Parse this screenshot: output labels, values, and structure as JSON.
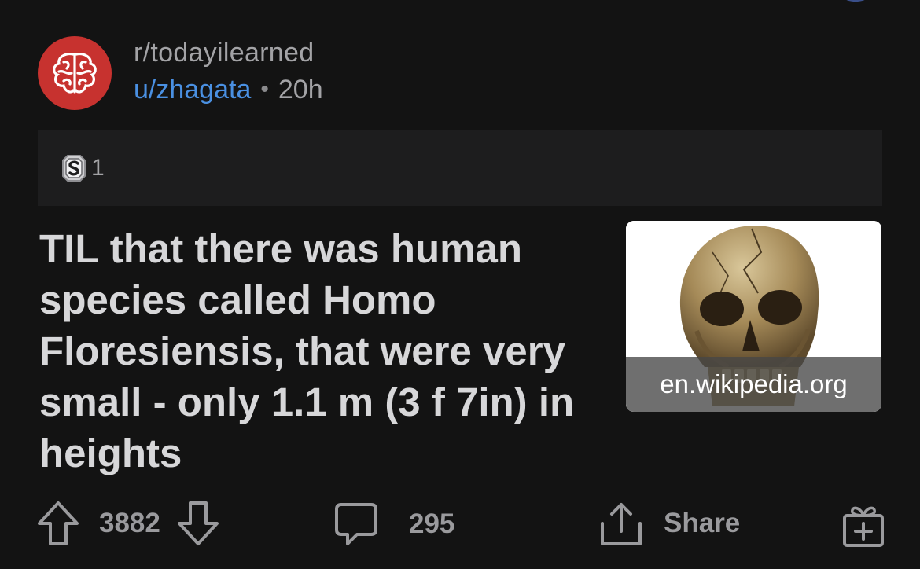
{
  "post": {
    "subreddit": "r/todayilearned",
    "username": "u/zhagata",
    "separator": "•",
    "time_ago": "20h",
    "awards": {
      "icon": "silver-award-icon",
      "count": "1"
    },
    "title": "TIL that there was human species called Homo Floresiensis, that were very small - only 1.1 m (3 f 7in) in heights",
    "thumbnail": {
      "domain": "en.wikipedia.org",
      "icon": "skull-thumbnail"
    },
    "actions": {
      "upvotes": "3882",
      "comments": "295",
      "share_label": "Share"
    }
  },
  "colors": {
    "background": "#131313",
    "subreddit_icon": "#c7322f",
    "username": "#4a90e2",
    "muted_text": "#a3a3a6",
    "title_text": "#d7d7d9"
  }
}
